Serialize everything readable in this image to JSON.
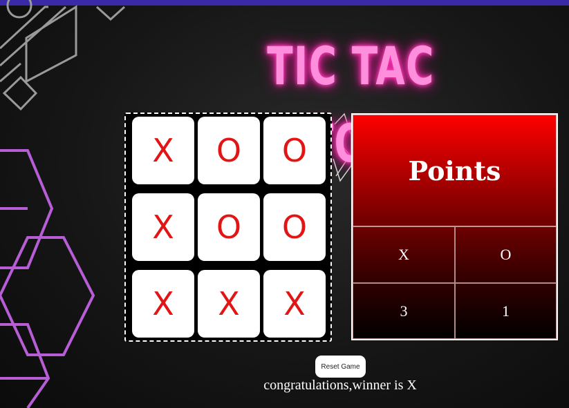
{
  "title": "TIC TAC TOE",
  "board": {
    "cells": [
      "X",
      "O",
      "O",
      "X",
      "O",
      "O",
      "X",
      "X",
      "X"
    ]
  },
  "points": {
    "title": "Points",
    "headers": [
      "X",
      "O"
    ],
    "scores": [
      "3",
      "1"
    ]
  },
  "reset_label": "Reset Game",
  "message": "congratulations,winner is X",
  "colors": {
    "top_bar": "#3a2aa8",
    "title_neon": "#ff8fdc",
    "mark": "#e21414",
    "points_top": "#ff0000",
    "decor_purple": "#b75ed6"
  }
}
